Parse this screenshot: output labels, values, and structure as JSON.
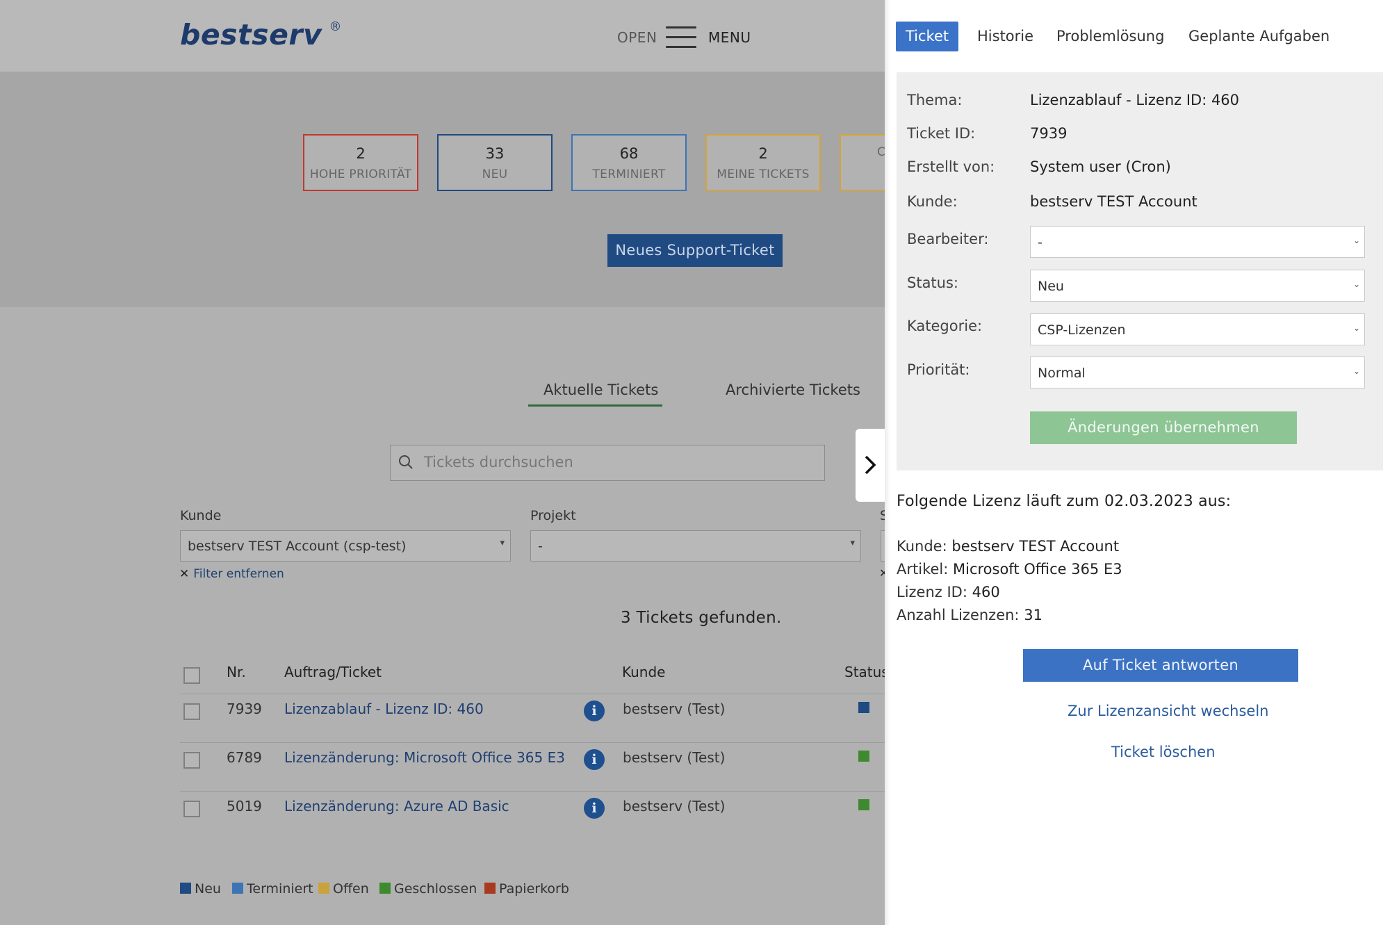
{
  "header": {
    "logo": "bestserv",
    "logo_mark": "®",
    "open_label": "OPEN",
    "menu_label": "MENU"
  },
  "stats": [
    {
      "count": "2",
      "label": "HOHE PRIORITÄT",
      "color": "#c0392b"
    },
    {
      "count": "33",
      "label": "NEU",
      "color": "#1f4a82"
    },
    {
      "count": "68",
      "label": "TERMINIERT",
      "color": "#3e74b3"
    },
    {
      "count": "2",
      "label": "MEINE TICKETS",
      "color": "#d4a43a"
    },
    {
      "count": "",
      "label": "C",
      "color": "#d4a43a"
    }
  ],
  "new_ticket_button": "Neues Support-Ticket",
  "tabs": {
    "current": "Aktuelle Tickets",
    "archived": "Archivierte Tickets"
  },
  "search": {
    "placeholder": "Tickets durchsuchen"
  },
  "filters": {
    "kunde_label": "Kunde",
    "kunde_value": "bestserv TEST Account (csp-test)",
    "projekt_label": "Projekt",
    "projekt_value": "-",
    "third_label": "S",
    "remove_filter": "Filter entfernen"
  },
  "tickets_found": "3 Tickets gefunden.",
  "table": {
    "headers": {
      "nr": "Nr.",
      "ticket": "Auftrag/Ticket",
      "kunde": "Kunde",
      "status": "Status"
    },
    "rows": [
      {
        "nr": "7939",
        "title": "Lizenzablauf - Lizenz ID: 460",
        "kunde": "bestserv (Test)",
        "status_color": "#1f4a82"
      },
      {
        "nr": "6789",
        "title": "Lizenzänderung: Microsoft Office 365 E3",
        "kunde": "bestserv (Test)",
        "status_color": "#3f8a2f"
      },
      {
        "nr": "5019",
        "title": "Lizenzänderung: Azure AD Basic",
        "kunde": "bestserv (Test)",
        "status_color": "#3f8a2f"
      }
    ]
  },
  "legend": [
    {
      "label": "Neu",
      "color": "#1f4a82"
    },
    {
      "label": "Terminiert",
      "color": "#3e74b3"
    },
    {
      "label": "Offen",
      "color": "#c9a23e"
    },
    {
      "label": "Geschlossen",
      "color": "#3f8a2f"
    },
    {
      "label": "Papierkorb",
      "color": "#a83a1e"
    }
  ],
  "panel": {
    "tabs": [
      "Ticket",
      "Historie",
      "Problemlösung",
      "Geplante Aufgaben"
    ],
    "fields": {
      "thema_label": "Thema:",
      "thema_value": "Lizenzablauf - Lizenz ID: 460",
      "ticket_id_label": "Ticket ID:",
      "ticket_id_value": "7939",
      "erstellt_label": "Erstellt von:",
      "erstellt_value": "System user (Cron)",
      "kunde_label": "Kunde:",
      "kunde_value": "bestserv TEST Account",
      "bearbeiter_label": "Bearbeiter:",
      "bearbeiter_value": "-",
      "status_label": "Status:",
      "status_value": "Neu",
      "kategorie_label": "Kategorie:",
      "kategorie_value": "CSP-Lizenzen",
      "prioritaet_label": "Priorität:",
      "prioritaet_value": "Normal"
    },
    "apply_button": "Änderungen übernehmen",
    "message": {
      "intro": "Folgende Lizenz läuft zum 02.03.2023 aus:",
      "kunde_label": "Kunde:",
      "kunde_value": "bestserv TEST Account",
      "artikel_label": "Artikel:",
      "artikel_value": "Microsoft Office 365 E3",
      "lizenz_label": "Lizenz ID:",
      "lizenz_value": "460",
      "anzahl_label": "Anzahl Lizenzen:",
      "anzahl_value": "31"
    },
    "reply_button": "Auf Ticket antworten",
    "switch_link": "Zur Lizenzansicht wechseln",
    "delete_link": "Ticket löschen"
  }
}
